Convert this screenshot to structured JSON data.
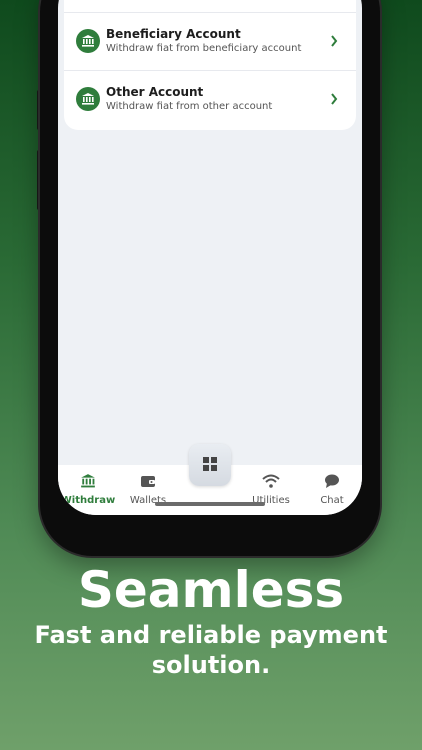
{
  "withdraw_options": [
    {
      "title": "Beneficiary Account",
      "subtitle": "Withdraw fiat from beneficiary account",
      "icon": "bank-icon"
    },
    {
      "title": "Other Account",
      "subtitle": "Withdraw fiat from other account",
      "icon": "bank-icon"
    }
  ],
  "nav": {
    "withdraw": "Withdraw",
    "wallets": "Wallets",
    "utilities": "Utilities",
    "chat": "Chat",
    "center_icon": "grid-icon"
  },
  "promo": {
    "headline": "Seamless",
    "subline": "Fast and reliable payment solution."
  },
  "colors": {
    "accent": "#2f7d3c"
  }
}
